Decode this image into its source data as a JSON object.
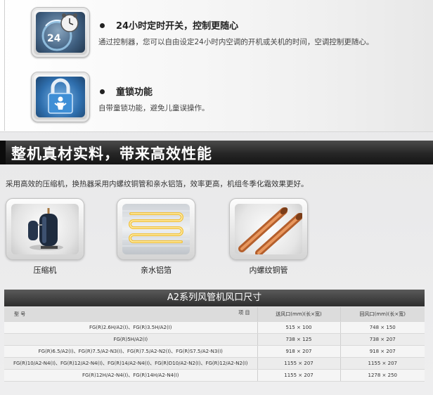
{
  "features": [
    {
      "title": "24小时定时开关，控制更随心",
      "desc": "通过控制器，您可以自由设定24小时内空调的开机或关机的时间，空调控制更随心。",
      "icon": "timer-24h-icon",
      "badge": "24"
    },
    {
      "title": "童锁功能",
      "desc": "自带童锁功能，避免儿童误操作。",
      "icon": "child-lock-icon"
    }
  ],
  "banner": {
    "title": "整机真材实料，带来高效性能",
    "desc": "采用高效的压缩机，换热器采用内螺纹铜管和亲水铝箔，效率更高，机组冬季化霜效果更好。"
  },
  "components": [
    {
      "label": "压缩机",
      "icon": "compressor-icon"
    },
    {
      "label": "亲水铝箔",
      "icon": "hydrophilic-foil-icon"
    },
    {
      "label": "内螺纹铜管",
      "icon": "copper-tube-icon"
    }
  ],
  "table": {
    "title": "A2系列风管机风口尺寸",
    "head": {
      "model_label": "型  号",
      "item_label": "项  目",
      "supply": "送风口(mm)(长×宽)",
      "return": "回风口(mm)(长×宽)"
    },
    "rows": [
      {
        "model": "FG(R)2.6H/A2(I)、FG(R)3.5H/A2(I)",
        "supply": "515 × 100",
        "return": "748 × 150"
      },
      {
        "model": "FG(R)5H/A2(I)",
        "supply": "738 × 125",
        "return": "738 × 207"
      },
      {
        "model": "FG(R)6.5/A2(I)、FG(R)7.5/A2-N3(I)、FG(R)7.5/A2-N2(I)、FG(R)S7.5/A2-N3(I)",
        "supply": "918 × 207",
        "return": "918 × 207"
      },
      {
        "model": "FG(R)10/A2-N4(I)、FG(R)12/A2-N4(I)、FG(R)14/A2-N4(I)、FG(R)D10/A2-N2(I)、FG(R)12/A2-N2(I)",
        "supply": "1155 × 207",
        "return": "1155 × 207"
      },
      {
        "model": "FG(R)12H/A2-N4(I)、FG(R)14H/A2-N4(I)",
        "supply": "1155 × 207",
        "return": "1278 × 250"
      }
    ]
  },
  "colors": {
    "banner_bg": "#262626",
    "icon_blue": "#3f5f80",
    "copper": "#c8703a",
    "foil_gold": "#f0c040"
  }
}
